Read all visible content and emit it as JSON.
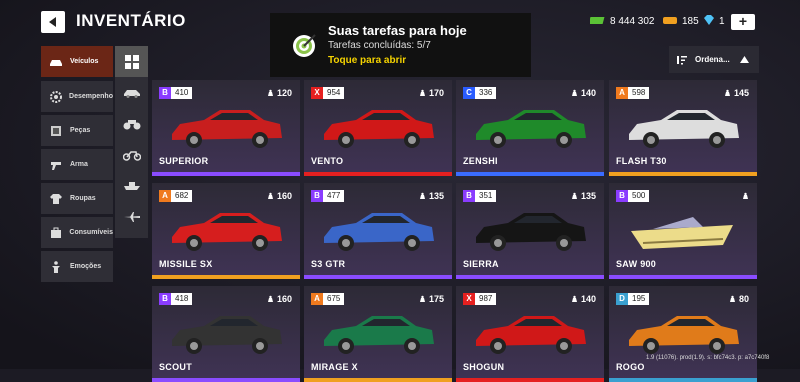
{
  "header": {
    "title": "INVENTÁRIO"
  },
  "tasks": {
    "title": "Suas tarefas para hoje",
    "progress": "Tarefas concluídas: 5/7",
    "cta": "Toque para abrir"
  },
  "currencies": [
    {
      "icon": "cash-icon",
      "value": "8 444 302"
    },
    {
      "icon": "fuel-icon",
      "value": "185"
    },
    {
      "icon": "diamond-icon",
      "value": "1"
    }
  ],
  "plus_label": "+",
  "sort": {
    "label": "Ordena..."
  },
  "sidebar": {
    "items": [
      {
        "label": "Veículos",
        "icon": "car-icon"
      },
      {
        "label": "Desempenho",
        "icon": "gear-icon"
      },
      {
        "label": "Peças",
        "icon": "parts-icon"
      },
      {
        "label": "Arma",
        "icon": "gun-icon"
      },
      {
        "label": "Roupas",
        "icon": "shirt-icon"
      },
      {
        "label": "Consumíveis",
        "icon": "box-icon"
      },
      {
        "label": "Emoções",
        "icon": "emote-icon"
      }
    ]
  },
  "filters": [
    "grid-icon",
    "car-filter-icon",
    "atv-filter-icon",
    "moto-filter-icon",
    "boat-filter-icon",
    "plane-filter-icon"
  ],
  "cards": [
    {
      "name": "SUPERIOR",
      "class": "B",
      "rating": "410",
      "weight": "120",
      "color": "#c81e1e",
      "bar": "#8a4cff"
    },
    {
      "name": "VENTO",
      "class": "X",
      "rating": "954",
      "weight": "170",
      "color": "#d01818",
      "bar": "#e52020"
    },
    {
      "name": "ZENSHI",
      "class": "C",
      "rating": "336",
      "weight": "140",
      "color": "#1f8a2a",
      "bar": "#3a6cff"
    },
    {
      "name": "FLASH T30",
      "class": "A",
      "rating": "598",
      "weight": "145",
      "color": "#dddddd",
      "bar": "#f0a020"
    },
    {
      "name": "MISSILE SX",
      "class": "A",
      "rating": "682",
      "weight": "160",
      "color": "#d61e1e",
      "bar": "#f0a020"
    },
    {
      "name": "S3 GTR",
      "class": "B",
      "rating": "477",
      "weight": "135",
      "color": "#3a66c8",
      "bar": "#8a4cff"
    },
    {
      "name": "SIERRA",
      "class": "B",
      "rating": "351",
      "weight": "135",
      "color": "#151515",
      "bar": "#8a4cff"
    },
    {
      "name": "SAW 900",
      "class": "B",
      "rating": "500",
      "weight": "",
      "color": "#ecdc8a",
      "bar": "#8a4cff"
    },
    {
      "name": "SCOUT",
      "class": "B",
      "rating": "418",
      "weight": "160",
      "color": "#333",
      "bar": "#8a4cff"
    },
    {
      "name": "MIRAGE X",
      "class": "A",
      "rating": "675",
      "weight": "175",
      "color": "#1a7a4a",
      "bar": "#f0a020"
    },
    {
      "name": "SHOGUN",
      "class": "X",
      "rating": "987",
      "weight": "140",
      "color": "#d01818",
      "bar": "#e52020"
    },
    {
      "name": "ROGO",
      "class": "D",
      "rating": "195",
      "weight": "80",
      "color": "#e07b1a",
      "bar": "#3aa0d0"
    }
  ],
  "class_colors": {
    "A": "#f07a1e",
    "B": "#8a3cff",
    "C": "#2a5cff",
    "D": "#3aa0d0",
    "X": "#e52020"
  },
  "version": "1.9 (11076). prod(1.9). s: bfc74c3. p: a7c740f8"
}
